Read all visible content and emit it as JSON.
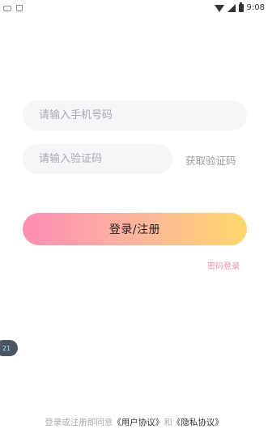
{
  "status_bar": {
    "time": "9:08"
  },
  "form": {
    "phone_placeholder": "请输入手机号码",
    "code_placeholder": "请输入验证码",
    "get_code_label": "获取验证码",
    "login_button_label": "登录/注册",
    "password_login_label": "密码登录"
  },
  "floating_bubble": {
    "text": "21"
  },
  "agreement": {
    "prefix": "登录或注册即同意",
    "user_agreement": "《用户协议》",
    "and": "和",
    "privacy_agreement": "《隐私协议》"
  },
  "colors": {
    "gradient_start": "#fd8eb4",
    "gradient_end": "#fdd86a",
    "link_pink": "#f08db2"
  }
}
